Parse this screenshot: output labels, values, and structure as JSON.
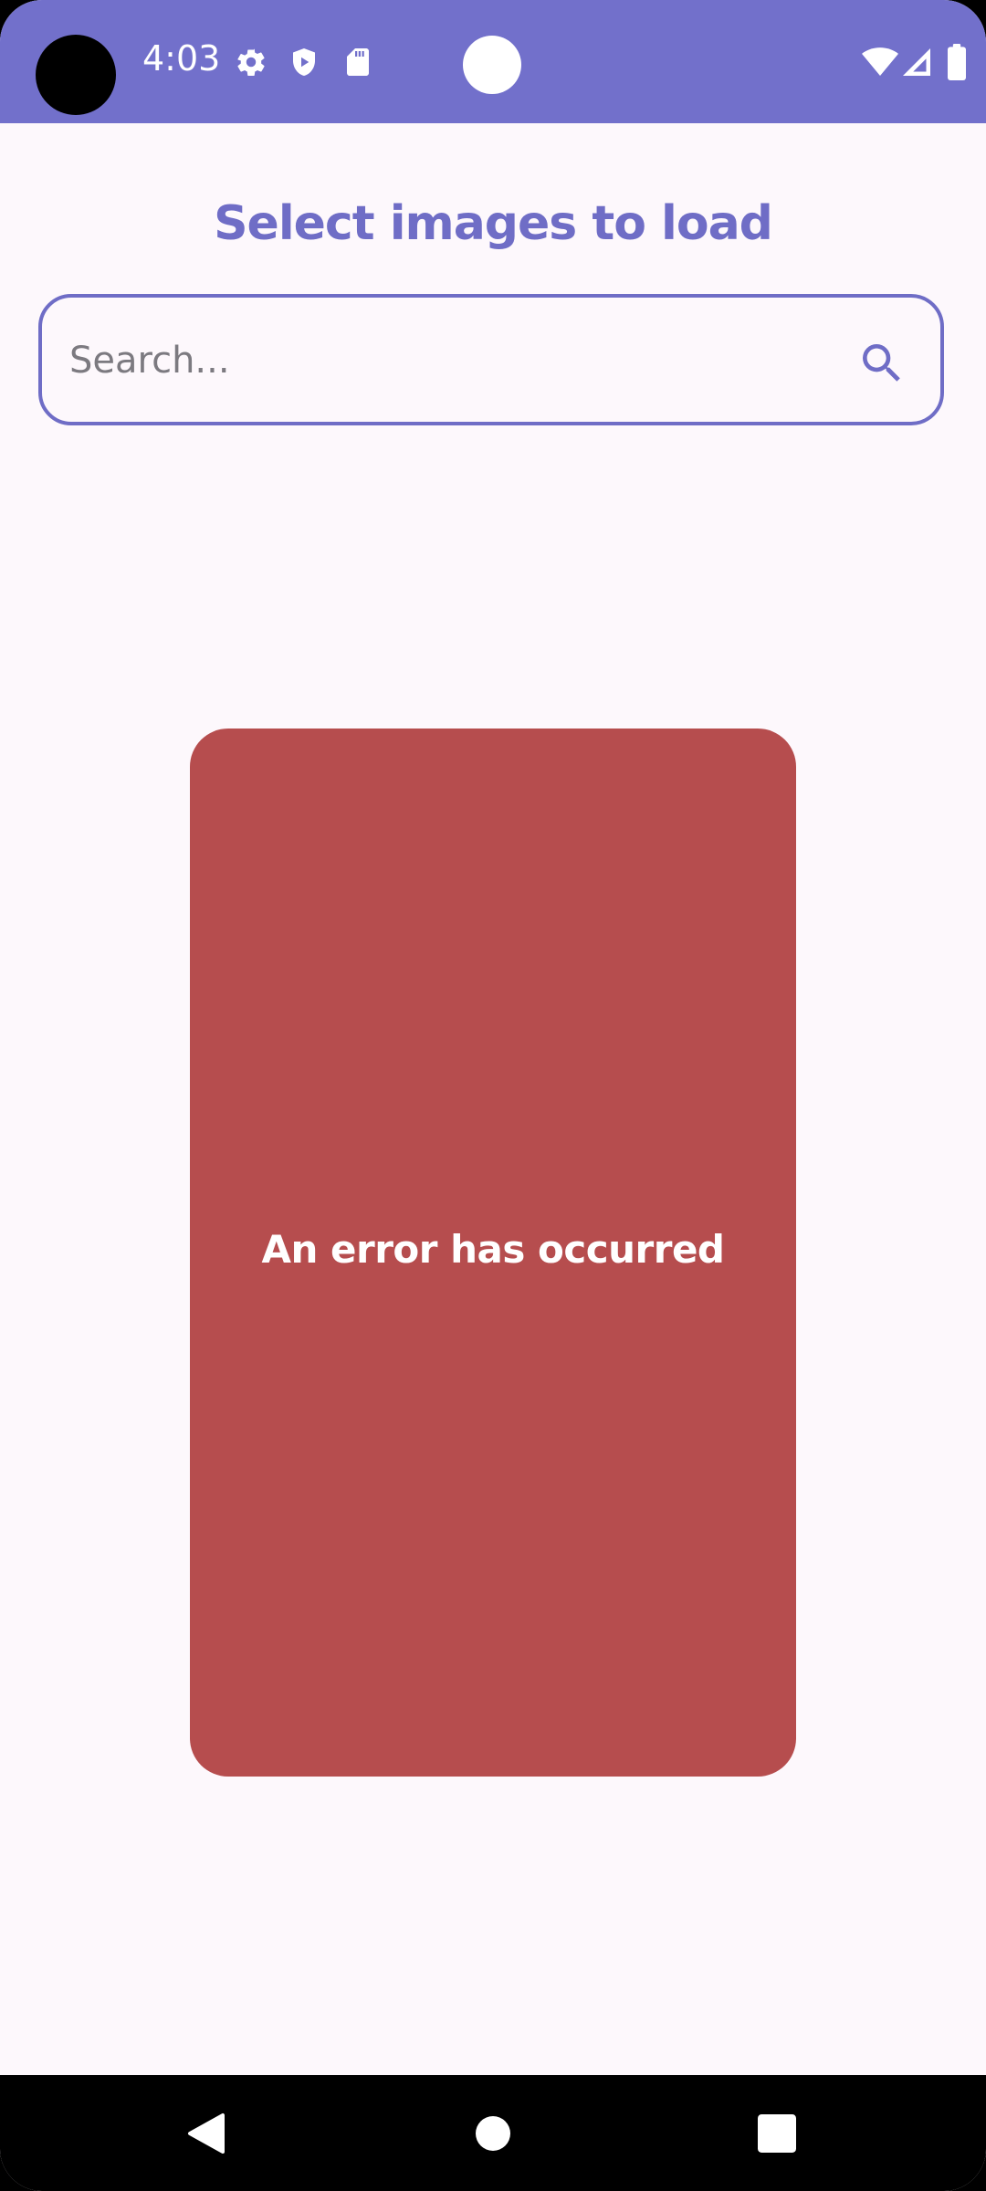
{
  "status_bar": {
    "time": "4:03",
    "background_color": "#7270cb",
    "left_icons": [
      "settings-gear-icon",
      "shield-play-icon",
      "sd-card-icon"
    ],
    "right_icons": [
      "wifi-icon",
      "cellular-signal-icon",
      "battery-icon"
    ]
  },
  "page": {
    "title": "Select images to load"
  },
  "search": {
    "placeholder": "Search...",
    "value": "",
    "icon": "search-icon"
  },
  "error_card": {
    "message": "An error has occurred",
    "color": "#b64d4e"
  },
  "navigation": {
    "buttons": [
      "back-icon",
      "home-icon",
      "recents-icon"
    ]
  },
  "colors": {
    "accent": "#6f6dc6",
    "background": "#fdf8fc"
  }
}
